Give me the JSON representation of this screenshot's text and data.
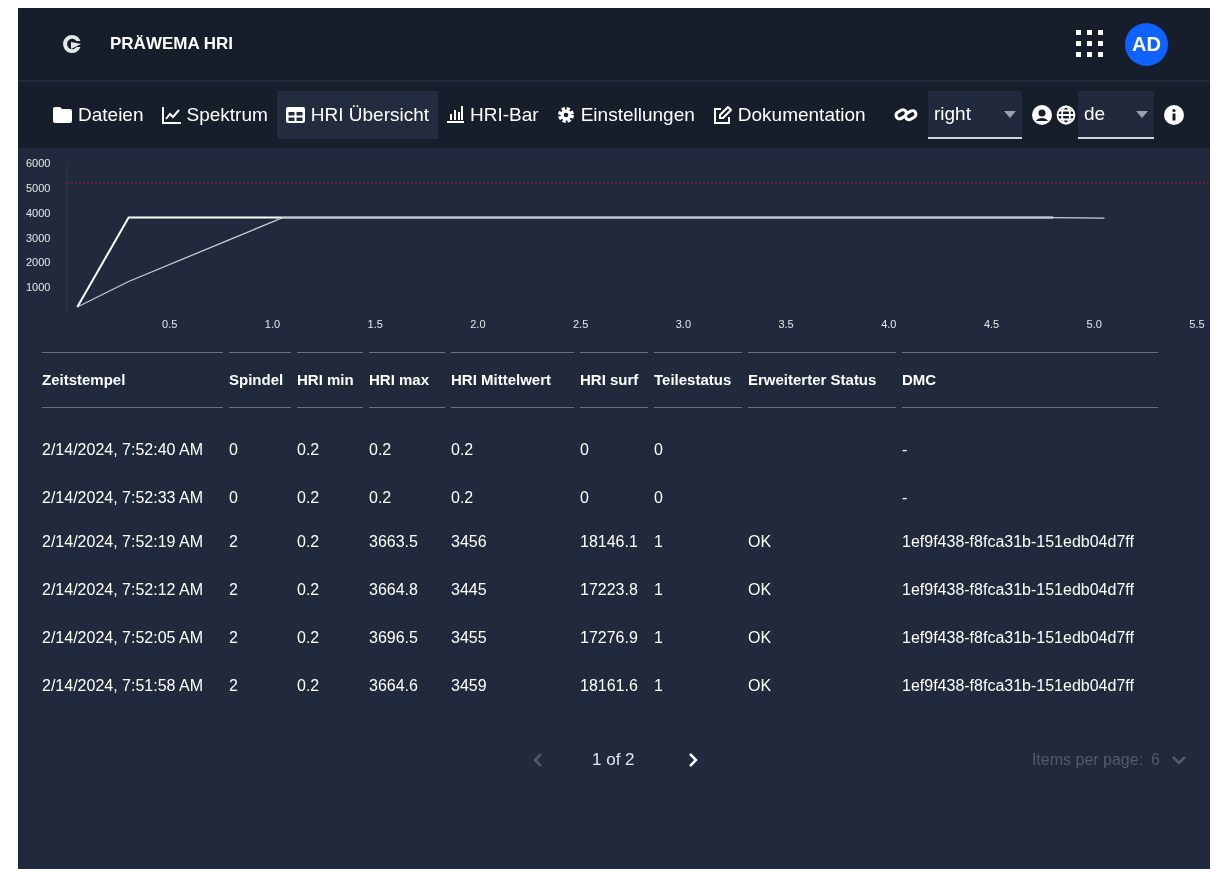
{
  "app": {
    "title": "PRÄWEMA HRI",
    "avatar": "AD"
  },
  "nav": {
    "tabs": [
      {
        "label": "Dateien",
        "selected": false
      },
      {
        "label": "Spektrum",
        "selected": false
      },
      {
        "label": "HRI Übersicht",
        "selected": true
      },
      {
        "label": "HRI-Bar",
        "selected": false
      },
      {
        "label": "Einstellungen",
        "selected": false
      },
      {
        "label": "Dokumentation",
        "selected": false
      }
    ],
    "side_select": {
      "value": "right"
    },
    "language_select": {
      "value": "de"
    }
  },
  "chart_data": {
    "type": "line",
    "x": [
      0.05,
      0.3,
      1.05,
      4.8,
      5.05
    ],
    "xlim": [
      0,
      5.5
    ],
    "ylim": [
      0,
      6000
    ],
    "xticks": [
      {
        "value": 0.5,
        "label": "0.5"
      },
      {
        "value": 1,
        "label": "1.0"
      },
      {
        "value": 1.5,
        "label": "1.5"
      },
      {
        "value": 2,
        "label": "2.0"
      },
      {
        "value": 2.5,
        "label": "2.5"
      },
      {
        "value": 3,
        "label": "3.0"
      },
      {
        "value": 3.5,
        "label": "3.5"
      },
      {
        "value": 4,
        "label": "4.0"
      },
      {
        "value": 4.5,
        "label": "4.5"
      },
      {
        "value": 5,
        "label": "5.0"
      },
      {
        "value": 5.5,
        "label": "5.5"
      }
    ],
    "yticks": [
      1000,
      2000,
      3000,
      4000,
      5000,
      6000
    ],
    "series": [
      {
        "color": "#ffffff",
        "values": [
          200,
          3800,
          3800,
          3800,
          null
        ]
      },
      {
        "color": "#c8ccd4",
        "values": [
          200,
          1230,
          3800,
          3800,
          3780
        ]
      }
    ],
    "ref_lines": [
      {
        "axis": "y",
        "value": 5200,
        "color": "#b91c1c"
      }
    ]
  },
  "table": {
    "columns": [
      "Zeitstempel",
      "Spindel",
      "HRI min",
      "HRI max",
      "HRI Mittelwert",
      "HRI surf",
      "Teilestatus",
      "Erweiterter Status",
      "DMC"
    ],
    "rows": [
      [
        "2/14/2024, 7:52:40 AM",
        "0",
        "0.2",
        "0.2",
        "0.2",
        "0",
        "0",
        "",
        "-"
      ],
      [
        "2/14/2024, 7:52:33 AM",
        "0",
        "0.2",
        "0.2",
        "0.2",
        "0",
        "0",
        "",
        "-"
      ],
      [
        "2/14/2024, 7:52:19 AM",
        "2",
        "0.2",
        "3663.5",
        "3456",
        "18146.1",
        "1",
        "OK",
        "1ef9f438-f8fca31b-151edb04d7ff"
      ],
      [
        "2/14/2024, 7:52:12 AM",
        "2",
        "0.2",
        "3664.8",
        "3445",
        "17223.8",
        "1",
        "OK",
        "1ef9f438-f8fca31b-151edb04d7ff"
      ],
      [
        "2/14/2024, 7:52:05 AM",
        "2",
        "0.2",
        "3696.5",
        "3455",
        "17276.9",
        "1",
        "OK",
        "1ef9f438-f8fca31b-151edb04d7ff"
      ],
      [
        "2/14/2024, 7:51:58 AM",
        "2",
        "0.2",
        "3664.6",
        "3459",
        "18161.6",
        "1",
        "OK",
        "1ef9f438-f8fca31b-151edb04d7ff"
      ]
    ]
  },
  "pagination": {
    "page": "1 of 2",
    "previous_disabled": true,
    "next_disabled": false,
    "items_per_page_label": "Items per page:",
    "items_per_page": "6"
  }
}
